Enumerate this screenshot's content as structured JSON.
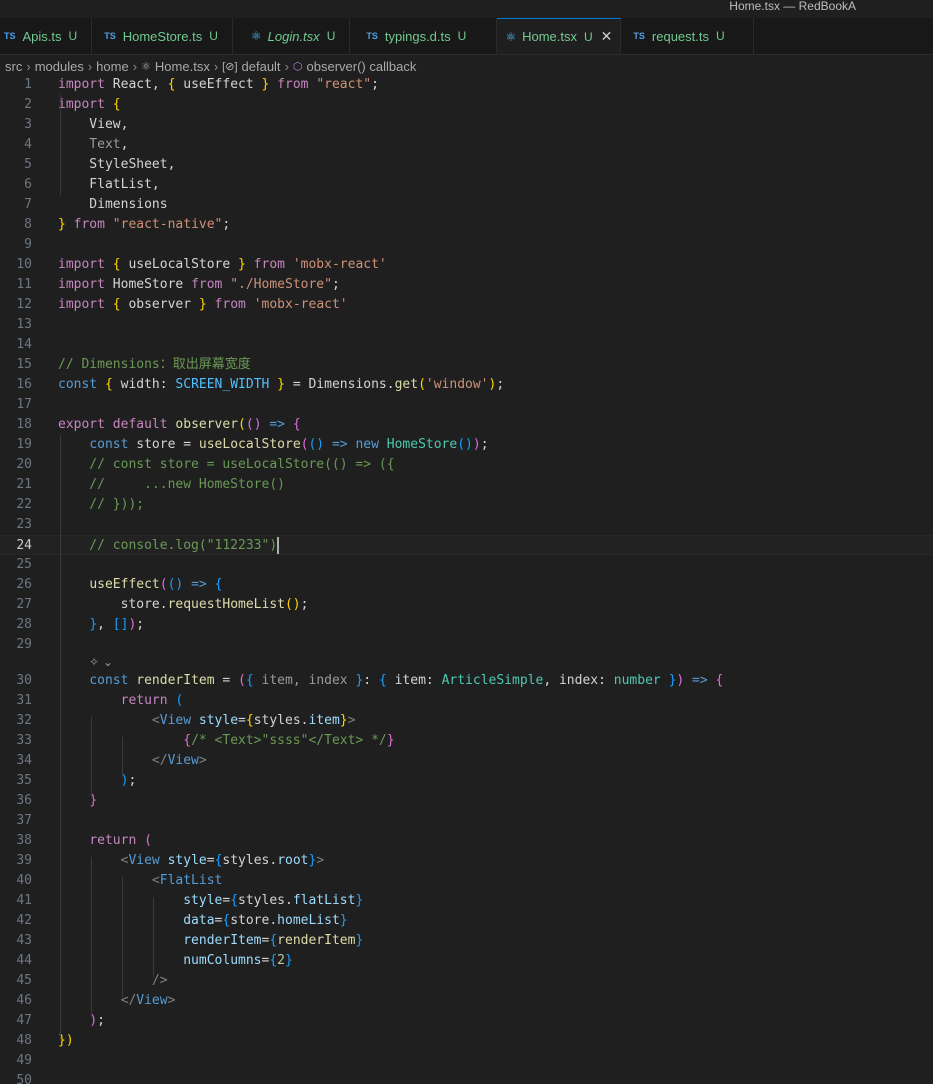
{
  "window": {
    "title": "Home.tsx — RedBookA"
  },
  "tabs": [
    {
      "icon": "ts-icon",
      "icon_label": "TS",
      "name": "Apis.ts",
      "status": "U",
      "italic": false,
      "active": false
    },
    {
      "icon": "ts-icon",
      "icon_label": "TS",
      "name": "HomeStore.ts",
      "status": "U",
      "italic": false,
      "active": false
    },
    {
      "icon": "react-icon",
      "icon_label": "⚛",
      "name": "Login.tsx",
      "status": "U",
      "italic": true,
      "active": false
    },
    {
      "icon": "ts-icon",
      "icon_label": "TS",
      "name": "typings.d.ts",
      "status": "U",
      "italic": false,
      "active": false
    },
    {
      "icon": "react-icon",
      "icon_label": "⚛",
      "name": "Home.tsx",
      "status": "U",
      "italic": false,
      "active": true,
      "close": "✕"
    },
    {
      "icon": "ts-icon",
      "icon_label": "TS",
      "name": "request.ts",
      "status": "U",
      "italic": false,
      "active": false
    }
  ],
  "breadcrumb": {
    "items": [
      "src",
      "modules",
      "home",
      "Home.tsx",
      "default",
      "observer() callback"
    ],
    "icons": {
      "file": "⚛",
      "symbol": "[⊘]",
      "callback": "⬡"
    },
    "separator": "›"
  },
  "editor": {
    "current_line": 24,
    "codelens_icon": "ai-sparkle-icon",
    "codelens_text": "✧ ⌄",
    "lines": [
      {
        "n": "1"
      },
      {
        "n": "2"
      },
      {
        "n": "3"
      },
      {
        "n": "4"
      },
      {
        "n": "5"
      },
      {
        "n": "6"
      },
      {
        "n": "7"
      },
      {
        "n": "8"
      },
      {
        "n": "9"
      },
      {
        "n": "10"
      },
      {
        "n": "11"
      },
      {
        "n": "12"
      },
      {
        "n": "13"
      },
      {
        "n": "14"
      },
      {
        "n": "15"
      },
      {
        "n": "16"
      },
      {
        "n": "17"
      },
      {
        "n": "18"
      },
      {
        "n": "19"
      },
      {
        "n": "20"
      },
      {
        "n": "21"
      },
      {
        "n": "22"
      },
      {
        "n": "23"
      },
      {
        "n": "24"
      },
      {
        "n": "25"
      },
      {
        "n": "26"
      },
      {
        "n": "27"
      },
      {
        "n": "28"
      },
      {
        "n": "29"
      },
      {
        "n": "30"
      },
      {
        "n": "31"
      },
      {
        "n": "32"
      },
      {
        "n": "33"
      },
      {
        "n": "34"
      },
      {
        "n": "35"
      },
      {
        "n": "36"
      },
      {
        "n": "37"
      },
      {
        "n": "38"
      },
      {
        "n": "39"
      },
      {
        "n": "40"
      },
      {
        "n": "41"
      },
      {
        "n": "42"
      },
      {
        "n": "43"
      },
      {
        "n": "44"
      },
      {
        "n": "45"
      },
      {
        "n": "46"
      },
      {
        "n": "47"
      },
      {
        "n": "48"
      },
      {
        "n": "49"
      },
      {
        "n": "50"
      }
    ],
    "tokens": {
      "l1": [
        "import",
        " React, ",
        "{",
        " useEffect ",
        "}",
        " from ",
        "\"react\"",
        ";"
      ],
      "l2": [
        "import",
        " ",
        "{"
      ],
      "l3": [
        "    View,"
      ],
      "l4": [
        "    Text",
        ","
      ],
      "l5": [
        "    StyleSheet,"
      ],
      "l6": [
        "    FlatList,"
      ],
      "l7": [
        "    Dimensions"
      ],
      "l8": [
        "}",
        " from ",
        "\"react-native\"",
        ";"
      ],
      "l10": [
        "import",
        " ",
        "{",
        " useLocalStore ",
        "}",
        " from ",
        "'mobx-react'"
      ],
      "l11": [
        "import",
        " HomeStore ",
        "from",
        " ",
        "\"./HomeStore\"",
        ";"
      ],
      "l12": [
        "import",
        " ",
        "{",
        " observer ",
        "}",
        " from ",
        "'mobx-react'"
      ],
      "l15": [
        "// Dimensions：取出屏幕宽度"
      ],
      "l16": [
        "const",
        " ",
        "{",
        " width: ",
        "SCREEN_WIDTH",
        " ",
        "}",
        " = Dimensions.",
        "get",
        "(",
        "'window'",
        ")",
        ";"
      ],
      "l18": [
        "export",
        " ",
        "default",
        " ",
        "observer",
        "(",
        "()",
        " => ",
        "{"
      ],
      "l19": [
        "    ",
        "const",
        " store = ",
        "useLocalStore",
        "(",
        "()",
        " => ",
        "new",
        " ",
        "HomeStore",
        "()",
        ")",
        ";"
      ],
      "l20": [
        "    // const store = useLocalStore(() => ({"
      ],
      "l21": [
        "    //     ...new HomeStore()"
      ],
      "l22": [
        "    // }));"
      ],
      "l24": [
        "    // console.log(\"112233\")"
      ],
      "l26": [
        "    ",
        "useEffect",
        "(",
        "()",
        " => ",
        "{"
      ],
      "l27": [
        "        store.",
        "requestHomeList",
        "()",
        ";"
      ],
      "l28": [
        "    ",
        "}",
        ", ",
        "[]",
        ")",
        ";"
      ],
      "l30": [
        "    ",
        "const",
        " ",
        "renderItem",
        " = ",
        "(",
        "{",
        " item, index ",
        "}",
        ": ",
        "{",
        " item: ",
        "ArticleSimple",
        ", index: ",
        "number",
        " ",
        "}",
        ")",
        " => ",
        "{"
      ],
      "l31": [
        "        ",
        "return",
        " ",
        "("
      ],
      "l32": [
        "            ",
        "<",
        "View",
        " ",
        "style",
        "=",
        "{",
        "styles.",
        "item",
        "}",
        ">"
      ],
      "l33": [
        "                ",
        "{",
        "/* <Text>\"ssss\"</Text> */",
        "}"
      ],
      "l34": [
        "            ",
        "</",
        "View",
        ">"
      ],
      "l35": [
        "        ",
        ")",
        ";"
      ],
      "l36": [
        "    ",
        "}"
      ],
      "l38": [
        "    ",
        "return",
        " ",
        "("
      ],
      "l39": [
        "        ",
        "<",
        "View",
        " ",
        "style",
        "=",
        "{",
        "styles.",
        "root",
        "}",
        ">"
      ],
      "l40": [
        "            ",
        "<",
        "FlatList"
      ],
      "l41": [
        "                ",
        "style",
        "=",
        "{",
        "styles.",
        "flatList",
        "}"
      ],
      "l42": [
        "                ",
        "data",
        "=",
        "{",
        "store.",
        "homeList",
        "}"
      ],
      "l43": [
        "                ",
        "renderItem",
        "=",
        "{",
        "renderItem",
        "}"
      ],
      "l44": [
        "                ",
        "numColumns",
        "=",
        "{",
        "2",
        "}"
      ],
      "l45": [
        "            ",
        "/>"
      ],
      "l46": [
        "        ",
        "</",
        "View",
        ">"
      ],
      "l47": [
        "    ",
        ")",
        ";"
      ],
      "l48": [
        "}",
        ")"
      ]
    }
  }
}
